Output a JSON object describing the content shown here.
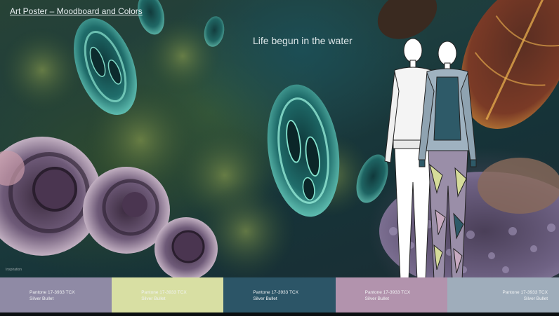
{
  "header": {
    "title": "Art Poster – Moodboard and Colors",
    "subtitle": "Life begun in the water"
  },
  "credit": "Inspiration",
  "swatches": [
    {
      "color": "#8f8aa5",
      "pantone": "Pantone 17-3933 TCX",
      "name": "Silver Bullet",
      "align": "left"
    },
    {
      "color": "#d8dfa3",
      "pantone": "Pantone 17-3933 TCX",
      "name": "Silver Bullet",
      "align": "left"
    },
    {
      "color": "#2c5567",
      "pantone": "Pantone 17-3933 TCX",
      "name": "Silver Bullet",
      "align": "left"
    },
    {
      "color": "#b293ad",
      "pantone": "Pantone 17-3933 TCX",
      "name": "Silver Bullet",
      "align": "left"
    },
    {
      "color": "#9fadbb",
      "pantone": "Pantone 17-3933 TCX",
      "name": "Silver Bullet",
      "align": "right"
    }
  ]
}
